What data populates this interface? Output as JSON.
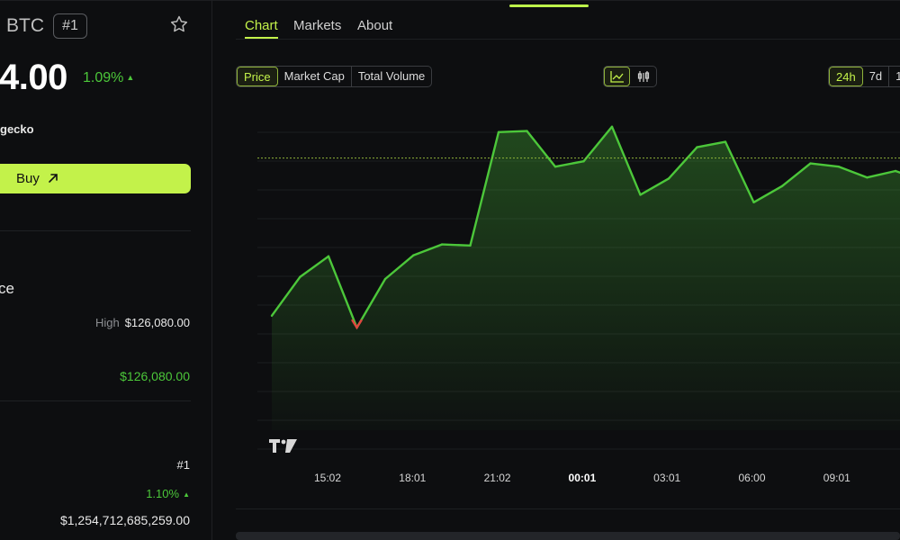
{
  "coin": {
    "symbol": "BTC",
    "rank": "#1",
    "price": "4.00",
    "change_pct": "1.09%",
    "source_label": "gecko",
    "buy_label": "Buy"
  },
  "range_section": {
    "title": "ce",
    "high_label": "High",
    "high_value": "$126,080.00",
    "ath_value": "$126,080.00"
  },
  "stats": {
    "rank_value": "#1",
    "change_value": "1.10%",
    "market_cap": "$1,254,712,685,259.00"
  },
  "tabs": [
    {
      "label": "Chart",
      "active": true
    },
    {
      "label": "Markets",
      "active": false
    },
    {
      "label": "About",
      "active": false
    }
  ],
  "metric_buttons": [
    {
      "label": "Price",
      "active": true
    },
    {
      "label": "Market Cap",
      "active": false
    },
    {
      "label": "Total Volume",
      "active": false
    }
  ],
  "range_buttons": [
    {
      "label": "24h",
      "active": true
    },
    {
      "label": "7d",
      "active": false
    },
    {
      "label": "1",
      "active": false
    }
  ],
  "colors": {
    "accent": "#c3f24a",
    "up": "#4cc73a",
    "down": "#e0463f",
    "line": "#4cc73a"
  },
  "chart_data": {
    "type": "area",
    "x_tick_labels": [
      "15:02",
      "18:01",
      "21:02",
      "00:01",
      "03:01",
      "06:00",
      "09:01"
    ],
    "x_tick_bold": "00:01",
    "values": [
      106,
      142,
      161,
      95,
      140,
      162,
      172,
      171,
      276,
      277,
      244,
      249,
      281,
      218,
      233,
      262,
      267,
      211,
      226,
      247,
      244,
      234,
      240,
      231
    ],
    "down_segment_index": 3,
    "reference_value": 252,
    "ylim": [
      0,
      300
    ],
    "grid": true,
    "watermark": "TV"
  }
}
